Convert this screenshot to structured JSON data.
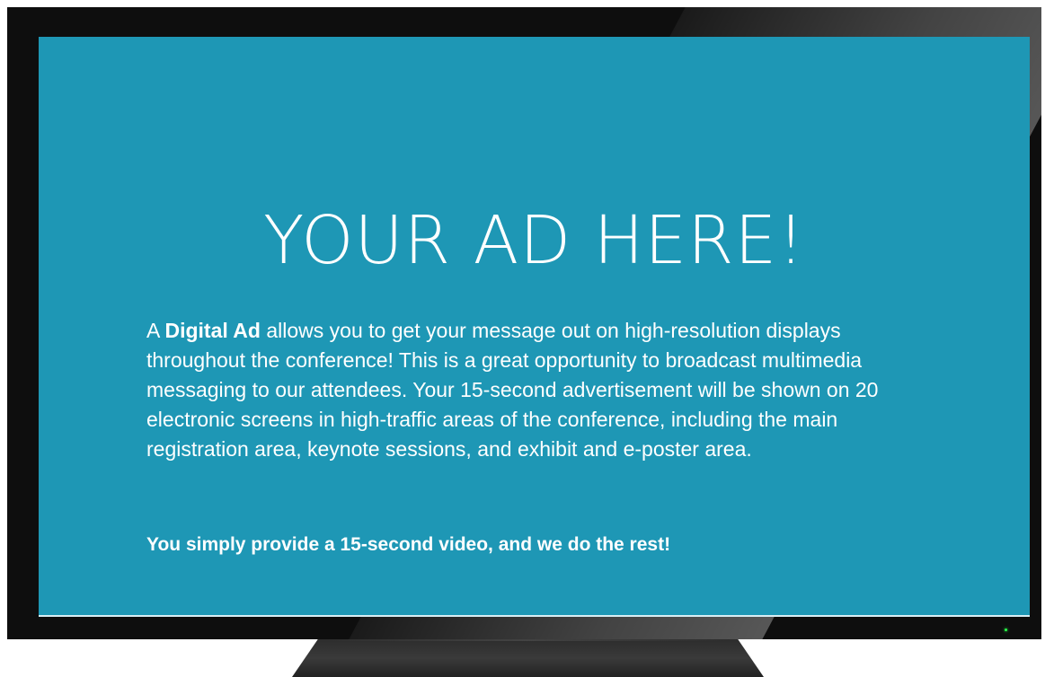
{
  "screen": {
    "headline": "YOUR AD HERE!",
    "intro_prefix": "A ",
    "intro_bold": "Digital Ad",
    "intro_rest": " allows you to get your message out on high-resolution displays throughout the conference! This is a great opportunity to broadcast multimedia messaging to our attendees. Your 15-second advertisement will be shown on 20 electronic screens in high-traffic areas of the conference, including the main registration area, keynote sessions, and exhibit and e-poster area.",
    "cta": "You simply provide a 15-second video, and we do the rest!"
  },
  "colors": {
    "screen_background": "#1e97b5",
    "bezel": "#0e0e0e",
    "text": "#ffffff",
    "power_led": "#2aff4a"
  }
}
